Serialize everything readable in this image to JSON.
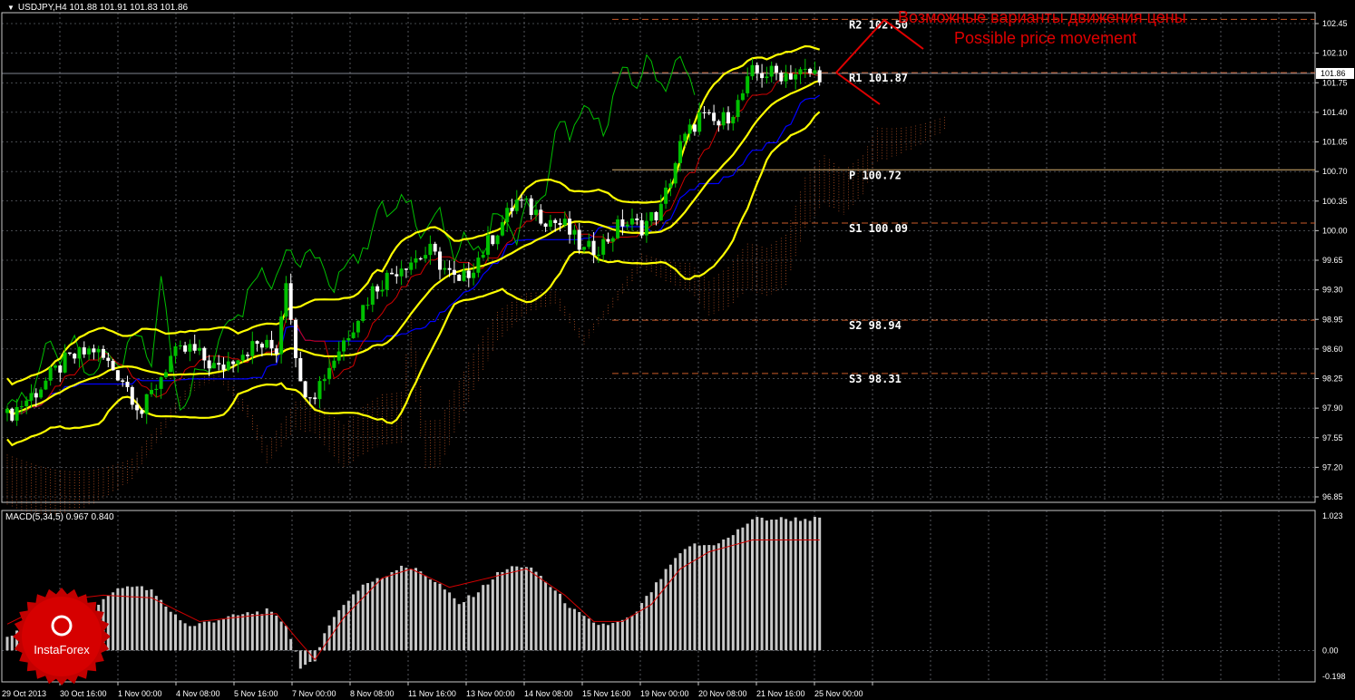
{
  "header": {
    "symbol": "USDJPY,H4",
    "quote": "101.88 101.91 101.83 101.86"
  },
  "macd_header": {
    "title": "MACD(5,34,5)",
    "values": "0.967 0.840"
  },
  "annotation": {
    "ru": "Возможные варианты движения цены",
    "en": "Possible price movement"
  },
  "logo": {
    "text": "InstaForex"
  },
  "colors": {
    "background": "#000000",
    "grid": "#8a8f9a",
    "bull": "#00c000",
    "bear": "#ffffff",
    "bollinger": "#ffff00",
    "tenkan": "#d00000",
    "kijun": "#0000ff",
    "chikou": "#00c000",
    "pivot_res": "#c85a28",
    "pivot_main": "#d8b070",
    "macd_hist": "#c8c8c8",
    "macd_signal": "#d00000",
    "annotation": "#e00000"
  },
  "chart_data": [
    {
      "type": "candlestick",
      "symbol": "USDJPY",
      "timeframe": "H4",
      "ylim": [
        96.85,
        102.45
      ],
      "y_ticks": [
        "102.45",
        "102.10",
        "101.75",
        "101.40",
        "101.05",
        "100.70",
        "100.35",
        "100.00",
        "99.65",
        "99.30",
        "98.95",
        "98.60",
        "98.25",
        "97.90",
        "97.55",
        "97.20",
        "96.85"
      ],
      "x_ticks": [
        "29 Oct 2013",
        "30 Oct 16:00",
        "1 Nov 00:00",
        "4 Nov 08:00",
        "5 Nov 16:00",
        "7 Nov 00:00",
        "8 Nov 08:00",
        "11 Nov 16:00",
        "13 Nov 00:00",
        "14 Nov 08:00",
        "15 Nov 16:00",
        "19 Nov 00:00",
        "20 Nov 08:00",
        "21 Nov 16:00",
        "25 Nov 00:00"
      ],
      "current_price": {
        "value": 101.86,
        "label": "101.86"
      },
      "pivot_levels": [
        {
          "label": "R2",
          "value": 102.5,
          "text": "R2 102.50"
        },
        {
          "label": "R1",
          "value": 101.87,
          "text": "R1 101.87"
        },
        {
          "label": "P",
          "value": 100.72,
          "text": "P 100.72"
        },
        {
          "label": "S1",
          "value": 100.09,
          "text": "S1 100.09"
        },
        {
          "label": "S2",
          "value": 98.94,
          "text": "S2 98.94"
        },
        {
          "label": "S3",
          "value": 98.31,
          "text": "S3 98.31"
        }
      ],
      "price_anchors": [
        [
          0,
          97.8
        ],
        [
          6,
          98.1
        ],
        [
          12,
          98.45
        ],
        [
          18,
          98.6
        ],
        [
          24,
          98.25
        ],
        [
          28,
          97.85
        ],
        [
          34,
          98.5
        ],
        [
          38,
          98.6
        ],
        [
          44,
          98.35
        ],
        [
          48,
          98.55
        ],
        [
          52,
          98.65
        ],
        [
          56,
          98.6
        ],
        [
          58,
          99.45
        ],
        [
          61,
          98.15
        ],
        [
          64,
          98.1
        ],
        [
          70,
          98.7
        ],
        [
          76,
          99.3
        ],
        [
          82,
          99.6
        ],
        [
          88,
          99.75
        ],
        [
          94,
          99.35
        ],
        [
          100,
          99.85
        ],
        [
          106,
          100.35
        ],
        [
          112,
          100.15
        ],
        [
          116,
          100.05
        ],
        [
          120,
          99.75
        ],
        [
          124,
          99.85
        ],
        [
          128,
          100.1
        ],
        [
          132,
          100.05
        ],
        [
          136,
          100.25
        ],
        [
          140,
          101.0
        ],
        [
          144,
          101.35
        ],
        [
          148,
          101.25
        ],
        [
          152,
          101.5
        ],
        [
          155,
          101.86
        ]
      ]
    },
    {
      "type": "bar",
      "name": "MACD(5,34,5)",
      "main": 0.967,
      "signal": 0.84,
      "ylim": [
        -0.198,
        1.023
      ],
      "y_ticks": [
        "1.023",
        "0.00",
        "-0.198"
      ],
      "hist_anchors": [
        [
          0,
          0.1
        ],
        [
          6,
          0.25
        ],
        [
          12,
          0.35
        ],
        [
          18,
          0.32
        ],
        [
          22,
          0.45
        ],
        [
          26,
          0.5
        ],
        [
          30,
          0.45
        ],
        [
          34,
          0.3
        ],
        [
          38,
          0.18
        ],
        [
          42,
          0.22
        ],
        [
          46,
          0.25
        ],
        [
          50,
          0.28
        ],
        [
          54,
          0.3
        ],
        [
          58,
          0.2
        ],
        [
          61,
          -0.12
        ],
        [
          64,
          -0.1
        ],
        [
          66,
          0.15
        ],
        [
          70,
          0.35
        ],
        [
          74,
          0.5
        ],
        [
          78,
          0.55
        ],
        [
          82,
          0.65
        ],
        [
          86,
          0.6
        ],
        [
          90,
          0.5
        ],
        [
          94,
          0.35
        ],
        [
          98,
          0.45
        ],
        [
          102,
          0.58
        ],
        [
          106,
          0.65
        ],
        [
          110,
          0.6
        ],
        [
          114,
          0.45
        ],
        [
          118,
          0.3
        ],
        [
          122,
          0.2
        ],
        [
          126,
          0.2
        ],
        [
          130,
          0.25
        ],
        [
          134,
          0.45
        ],
        [
          138,
          0.65
        ],
        [
          142,
          0.8
        ],
        [
          146,
          0.8
        ],
        [
          150,
          0.85
        ],
        [
          155,
          1.0
        ]
      ],
      "signal_anchors": [
        [
          0,
          0.2
        ],
        [
          10,
          0.38
        ],
        [
          20,
          0.42
        ],
        [
          30,
          0.4
        ],
        [
          40,
          0.22
        ],
        [
          50,
          0.26
        ],
        [
          56,
          0.28
        ],
        [
          60,
          0.1
        ],
        [
          64,
          -0.07
        ],
        [
          70,
          0.25
        ],
        [
          78,
          0.55
        ],
        [
          84,
          0.62
        ],
        [
          92,
          0.48
        ],
        [
          100,
          0.55
        ],
        [
          108,
          0.62
        ],
        [
          116,
          0.42
        ],
        [
          122,
          0.22
        ],
        [
          128,
          0.22
        ],
        [
          134,
          0.35
        ],
        [
          140,
          0.62
        ],
        [
          146,
          0.75
        ],
        [
          155,
          0.84
        ]
      ]
    }
  ]
}
